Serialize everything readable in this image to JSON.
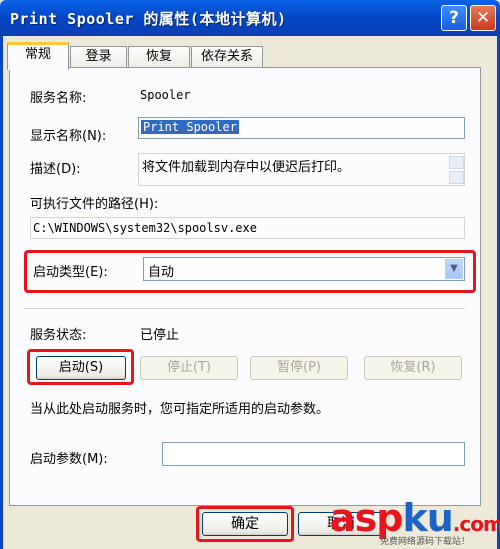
{
  "window": {
    "title": "Print Spooler 的属性(本地计算机)",
    "help_label": "?",
    "close_label": "✕"
  },
  "tabs": [
    {
      "label": "常规",
      "active": true
    },
    {
      "label": "登录",
      "active": false
    },
    {
      "label": "恢复",
      "active": false
    },
    {
      "label": "依存关系",
      "active": false
    }
  ],
  "general": {
    "service_name_label": "服务名称:",
    "service_name_value": "Spooler",
    "display_name_label": "显示名称(N):",
    "display_name_value": "Print Spooler",
    "description_label": "描述(D):",
    "description_value": "将文件加载到内存中以便迟后打印。",
    "exe_path_label": "可执行文件的路径(H):",
    "exe_path_value": "C:\\WINDOWS\\system32\\spoolsv.exe",
    "startup_type_label": "启动类型(E):",
    "startup_type_value": "自动",
    "service_status_label": "服务状态:",
    "service_status_value": "已停止",
    "start_button": "启动(S)",
    "stop_button": "停止(T)",
    "pause_button": "暂停(P)",
    "resume_button": "恢复(R)",
    "hint_text": "当从此处启动服务时，您可指定所适用的启动参数。",
    "start_params_label": "启动参数(M):",
    "start_params_value": ""
  },
  "footer": {
    "ok_button": "确定",
    "cancel_button": "取消"
  },
  "watermark": {
    "text_a": "asp",
    "text_b": "ku",
    "text_c": ".com",
    "subtext": "免费网络源码下载站！",
    "colors": {
      "red": "#e8141e",
      "blue": "#1e64c8"
    }
  }
}
